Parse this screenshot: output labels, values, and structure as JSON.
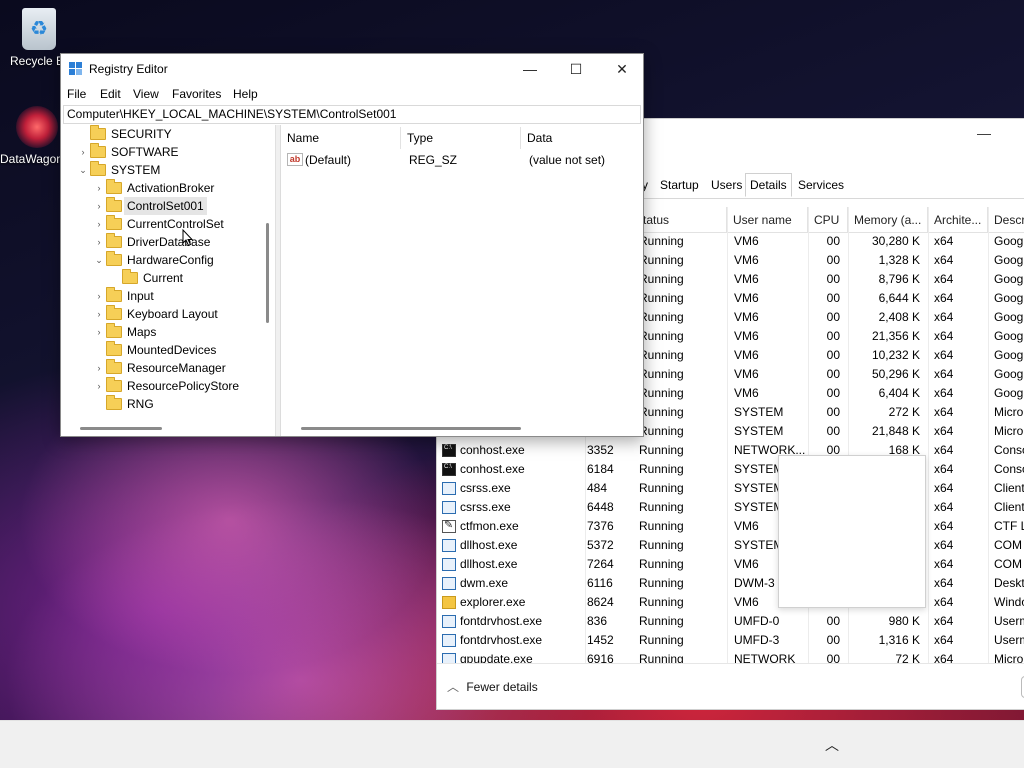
{
  "desktop": {
    "icons": [
      {
        "label": "Recycle Bin",
        "icon": "recycle-bin-icon"
      },
      {
        "label": "DataWagon",
        "icon": "datawagon-icon"
      }
    ]
  },
  "registry_editor": {
    "title": "Registry Editor",
    "window_buttons": {
      "minimize": "—",
      "maximize": "☐",
      "close": "✕"
    },
    "menu": [
      "File",
      "Edit",
      "View",
      "Favorites",
      "Help"
    ],
    "address": "Computer\\HKEY_LOCAL_MACHINE\\SYSTEM\\ControlSet001",
    "tree": [
      {
        "label": "SECURITY",
        "arrow": ""
      },
      {
        "label": "SOFTWARE",
        "arrow": "›"
      },
      {
        "label": "SYSTEM",
        "arrow": "⌄"
      },
      {
        "label": "ActivationBroker",
        "arrow": "›"
      },
      {
        "label": "ControlSet001",
        "arrow": "›",
        "selected": true
      },
      {
        "label": "CurrentControlSet",
        "arrow": "›"
      },
      {
        "label": "DriverDatabase",
        "arrow": "›"
      },
      {
        "label": "HardwareConfig",
        "arrow": "⌄"
      },
      {
        "label": "Current",
        "arrow": ""
      },
      {
        "label": "Input",
        "arrow": "›"
      },
      {
        "label": "Keyboard Layout",
        "arrow": "›"
      },
      {
        "label": "Maps",
        "arrow": "›"
      },
      {
        "label": "MountedDevices",
        "arrow": ""
      },
      {
        "label": "ResourceManager",
        "arrow": "›"
      },
      {
        "label": "ResourcePolicyStore",
        "arrow": "›"
      },
      {
        "label": "RNG",
        "arrow": ""
      }
    ],
    "values_columns": [
      "Name",
      "Type",
      "Data"
    ],
    "values": [
      {
        "name": "(Default)",
        "type": "REG_SZ",
        "data": "(value not set)"
      }
    ]
  },
  "task_manager": {
    "tabs": [
      "y",
      "Startup",
      "Users",
      "Details",
      "Services"
    ],
    "active_tab": "Details",
    "columns": [
      "tatus",
      "User name",
      "CPU",
      "Memory (a...",
      "Archite...",
      "Descri"
    ],
    "rows": [
      {
        "name": "",
        "pid": "",
        "status": "Running",
        "user": "VM6",
        "cpu": "00",
        "mem": "30,280 K",
        "arch": "x64",
        "desc": "Googl"
      },
      {
        "name": "",
        "pid": "",
        "status": "Running",
        "user": "VM6",
        "cpu": "00",
        "mem": "1,328 K",
        "arch": "x64",
        "desc": "Googl"
      },
      {
        "name": "",
        "pid": "",
        "status": "Running",
        "user": "VM6",
        "cpu": "00",
        "mem": "8,796 K",
        "arch": "x64",
        "desc": "Googl"
      },
      {
        "name": "",
        "pid": "",
        "status": "Running",
        "user": "VM6",
        "cpu": "00",
        "mem": "6,644 K",
        "arch": "x64",
        "desc": "Googl"
      },
      {
        "name": "",
        "pid": "",
        "status": "Running",
        "user": "VM6",
        "cpu": "00",
        "mem": "2,408 K",
        "arch": "x64",
        "desc": "Googl"
      },
      {
        "name": "",
        "pid": "",
        "status": "Running",
        "user": "VM6",
        "cpu": "00",
        "mem": "21,356 K",
        "arch": "x64",
        "desc": "Googl"
      },
      {
        "name": "",
        "pid": "",
        "status": "Running",
        "user": "VM6",
        "cpu": "00",
        "mem": "10,232 K",
        "arch": "x64",
        "desc": "Googl"
      },
      {
        "name": "",
        "pid": "",
        "status": "Running",
        "user": "VM6",
        "cpu": "00",
        "mem": "50,296 K",
        "arch": "x64",
        "desc": "Googl"
      },
      {
        "name": "",
        "pid": "",
        "status": "Running",
        "user": "VM6",
        "cpu": "00",
        "mem": "6,404 K",
        "arch": "x64",
        "desc": "Googl"
      },
      {
        "name": "",
        "pid": "",
        "status": "Running",
        "user": "SYSTEM",
        "cpu": "00",
        "mem": "272 K",
        "arch": "x64",
        "desc": "Micro"
      },
      {
        "name": "",
        "pid": "",
        "status": "Running",
        "user": "SYSTEM",
        "cpu": "00",
        "mem": "21,848 K",
        "arch": "x64",
        "desc": "Micro"
      },
      {
        "name": "conhost.exe",
        "icon": "console",
        "pid": "3352",
        "status": "Running",
        "user": "NETWORK...",
        "cpu": "00",
        "mem": "168 K",
        "arch": "x64",
        "desc": "Conso"
      },
      {
        "name": "conhost.exe",
        "icon": "console",
        "pid": "6184",
        "status": "Running",
        "user": "SYSTEM",
        "cpu": "",
        "mem": "",
        "arch": "x64",
        "desc": "Conso"
      },
      {
        "name": "csrss.exe",
        "icon": "window",
        "pid": "484",
        "status": "Running",
        "user": "SYSTEM",
        "cpu": "",
        "mem": "",
        "arch": "x64",
        "desc": "Client"
      },
      {
        "name": "csrss.exe",
        "icon": "window",
        "pid": "6448",
        "status": "Running",
        "user": "SYSTEM",
        "cpu": "",
        "mem": "",
        "arch": "x64",
        "desc": "Client"
      },
      {
        "name": "ctfmon.exe",
        "icon": "pen",
        "pid": "7376",
        "status": "Running",
        "user": "VM6",
        "cpu": "",
        "mem": "",
        "arch": "x64",
        "desc": "CTF Lo"
      },
      {
        "name": "dllhost.exe",
        "icon": "window",
        "pid": "5372",
        "status": "Running",
        "user": "SYSTEM",
        "cpu": "",
        "mem": "",
        "arch": "x64",
        "desc": "COM"
      },
      {
        "name": "dllhost.exe",
        "icon": "window",
        "pid": "7264",
        "status": "Running",
        "user": "VM6",
        "cpu": "",
        "mem": "",
        "arch": "x64",
        "desc": "COM"
      },
      {
        "name": "dwm.exe",
        "icon": "window",
        "pid": "6116",
        "status": "Running",
        "user": "DWM-3",
        "cpu": "",
        "mem": "",
        "arch": "x64",
        "desc": "Deskto"
      },
      {
        "name": "explorer.exe",
        "icon": "folder",
        "pid": "8624",
        "status": "Running",
        "user": "VM6",
        "cpu": "",
        "mem": "",
        "arch": "x64",
        "desc": "Windo"
      },
      {
        "name": "fontdrvhost.exe",
        "icon": "window",
        "pid": "836",
        "status": "Running",
        "user": "UMFD-0",
        "cpu": "00",
        "mem": "980 K",
        "arch": "x64",
        "desc": "Userm"
      },
      {
        "name": "fontdrvhost.exe",
        "icon": "window",
        "pid": "1452",
        "status": "Running",
        "user": "UMFD-3",
        "cpu": "00",
        "mem": "1,316 K",
        "arch": "x64",
        "desc": "Userm"
      },
      {
        "name": "gpupdate.exe",
        "icon": "window",
        "pid": "6916",
        "status": "Running",
        "user": "NETWORK",
        "cpu": "00",
        "mem": "72 K",
        "arch": "x64",
        "desc": "Micro"
      }
    ],
    "footer": {
      "fewer_details": "Fewer details",
      "chevron": "︿"
    }
  },
  "taskbar": {
    "tray_chevron": "︿"
  }
}
